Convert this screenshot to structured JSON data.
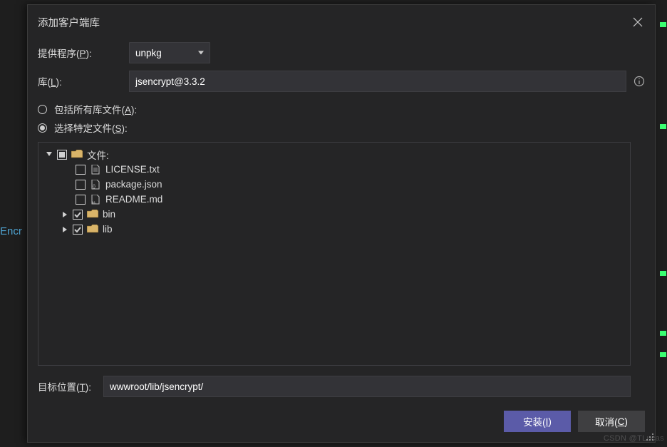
{
  "bg_word": "Encr",
  "dialog": {
    "title": "添加客户端库",
    "provider_label": "提供程序(P):",
    "provider_key": "P",
    "provider_value": "unpkg",
    "library_label": "库(L):",
    "library_key": "L",
    "library_value": "jsencrypt@3.3.2",
    "radio_all": "包括所有库文件(A):",
    "radio_all_key": "A",
    "radio_select": "选择特定文件(S):",
    "radio_select_key": "S",
    "tree": {
      "root_label": "文件:",
      "files": [
        {
          "name": "LICENSE.txt",
          "kind": "txt",
          "checked": false
        },
        {
          "name": "package.json",
          "kind": "json",
          "checked": false
        },
        {
          "name": "README.md",
          "kind": "md",
          "checked": false
        }
      ],
      "folders": [
        {
          "name": "bin",
          "checked": true
        },
        {
          "name": "lib",
          "checked": true
        }
      ]
    },
    "target_label": "目标位置(T):",
    "target_key": "T",
    "target_value": "wwwroot/lib/jsencrypt/",
    "install_btn": "安装(I)",
    "install_key": "I",
    "cancel_btn": "取消(C)",
    "cancel_key": "C"
  },
  "watermark": "CSDN @TLucas"
}
